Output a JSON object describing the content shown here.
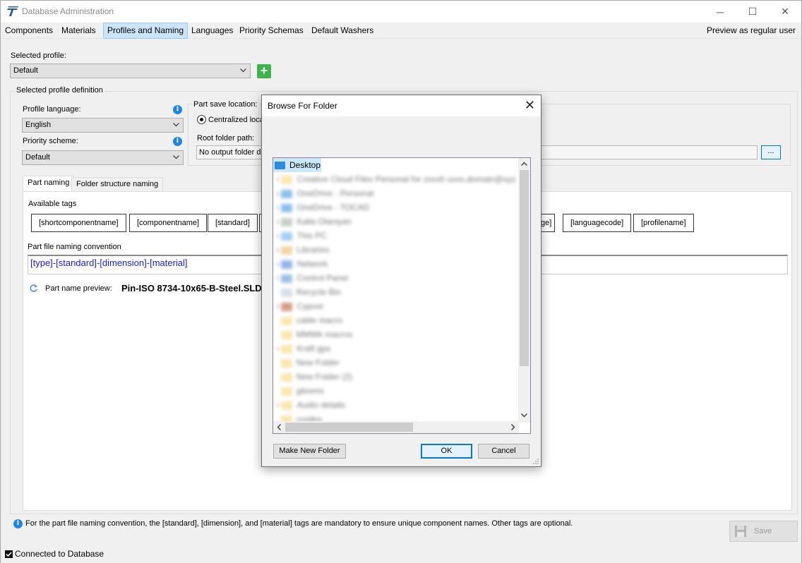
{
  "window": {
    "title": "Database Administration",
    "controls": {
      "minimize": "─",
      "maximize": "☐",
      "close": "✕"
    }
  },
  "menu": {
    "items": [
      "Components",
      "Materials",
      "Profiles and Naming",
      "Languages",
      "Priority Schemas",
      "Default Washers"
    ],
    "active": "Profiles and Naming",
    "right": "Preview as regular user"
  },
  "profile": {
    "selected_label": "Selected profile:",
    "selected_value": "Default",
    "add_button": "+"
  },
  "definition": {
    "group_title": "Selected profile definition",
    "language_label": "Profile language:",
    "language_value": "English",
    "priority_label": "Priority scheme:",
    "priority_value": "Default",
    "save_location_label": "Part save location:",
    "centralized_label": "Centralized loca",
    "root_folder_label": "Root folder path:",
    "root_folder_value": "No output folder de",
    "browse_button": "..."
  },
  "tabs": [
    "Part naming",
    "Folder structure naming"
  ],
  "part_naming": {
    "available_tags_label": "Available tags",
    "tags_left": [
      "[shortcomponentname]",
      "[componentname]",
      "[standard]"
    ],
    "tags_right": [
      "ge]",
      "[languagecode]",
      "[profilename]"
    ],
    "convention_label": "Part file naming convention",
    "convention_value": "[type]-[standard]-[dimension]-[material]",
    "preview_label": "Part name preview:",
    "preview_value": "Pin-ISO 8734-10x65-B-Steel.SLD"
  },
  "footer": {
    "note": "For the part file naming convention, the [standard], [dimension], and [material] tags are mandatory to ensure unique component names. Other tags are optional.",
    "save_button": "Save",
    "status": "Connected to Database"
  },
  "dialog": {
    "title": "Browse For Folder",
    "close": "✕",
    "selected_item": "Desktop",
    "items": [
      "Creative Cloud Files Personal for zxxxh xxxx.domain@xyz",
      "OneDrive - Personal",
      "OneDrive - TOCAD",
      "Kalla Olaniyan",
      "This PC",
      "Libraries",
      "Network",
      "Control Panel",
      "Recycle Bin",
      "Cypost",
      "cable macro",
      "MMWk macros",
      "Kraft gps",
      "New Folder",
      "New Folder (2)",
      "gitrems",
      "Audio details",
      "cosilex"
    ],
    "make_new_folder": "Make New Folder",
    "ok": "OK",
    "cancel": "Cancel"
  },
  "colors": {
    "accent": "#0078d7",
    "active_menu": "#cce4f7",
    "tag_text": "#1a1ad6",
    "add_green": "#3cb54a",
    "info_blue": "#1c86e0"
  }
}
